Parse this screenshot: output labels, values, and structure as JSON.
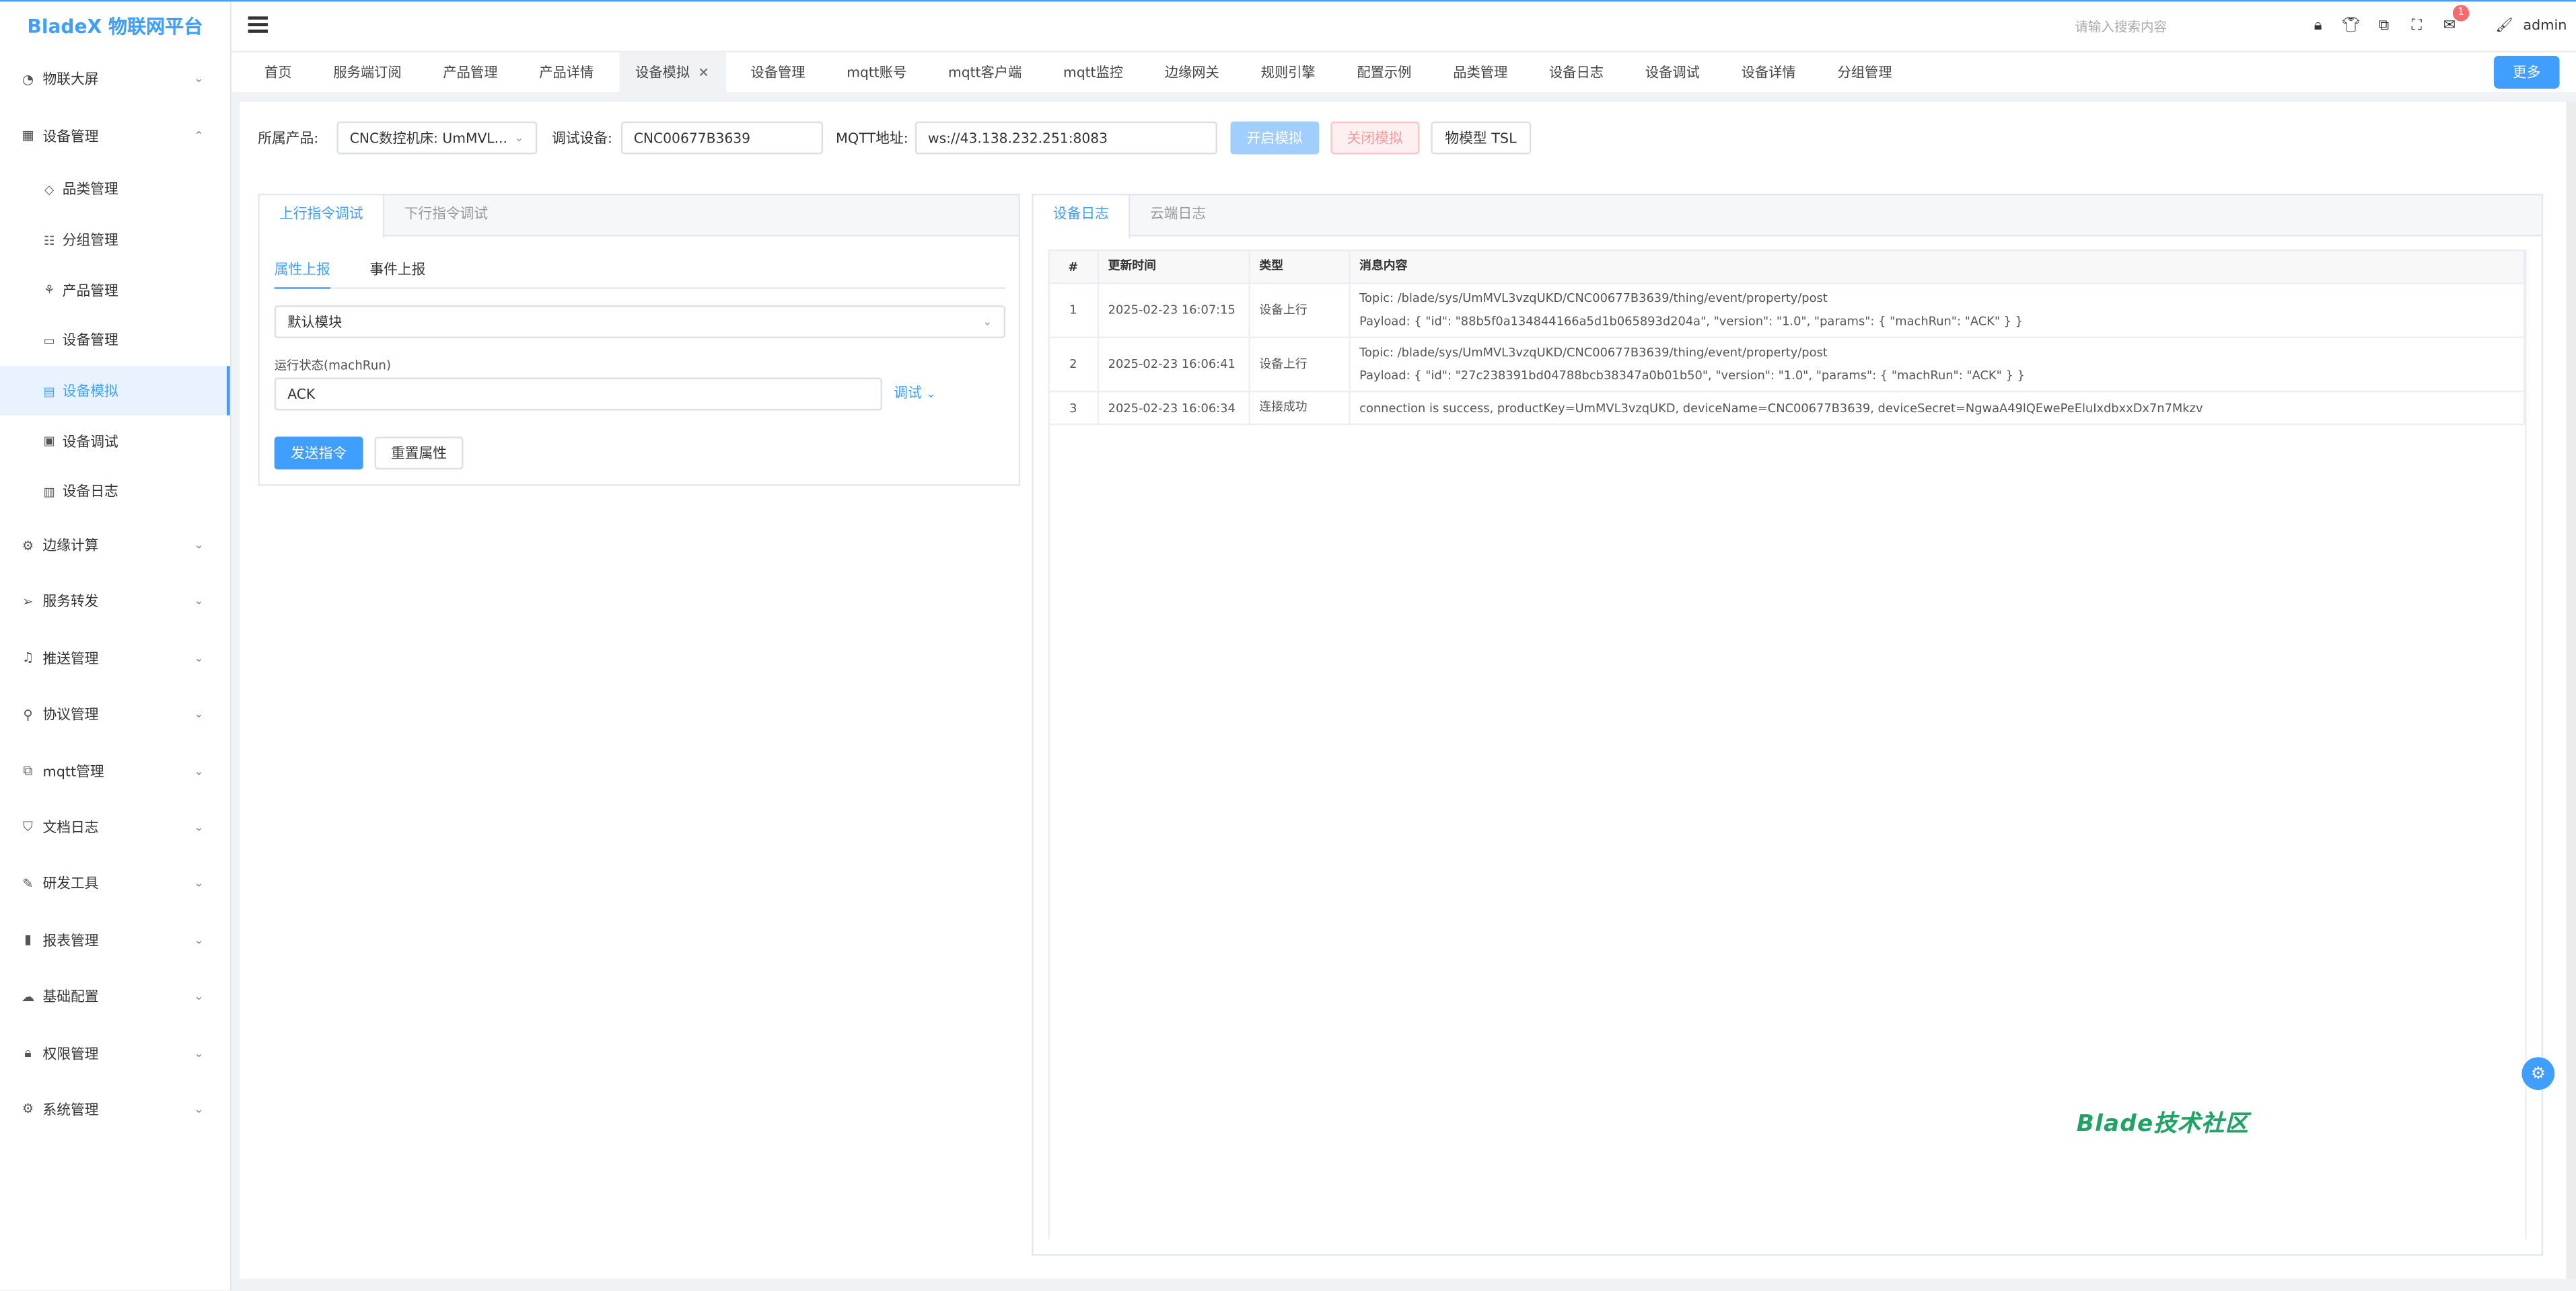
{
  "app": {
    "logo": "BladeX 物联网平台"
  },
  "sidebar": {
    "items": [
      {
        "label": "物联大屏",
        "icon": "dashboard-icon",
        "expanded": false
      },
      {
        "label": "设备管理",
        "icon": "device-icon",
        "expanded": true
      },
      {
        "label": "边缘计算",
        "icon": "edge-icon",
        "expanded": false
      },
      {
        "label": "服务转发",
        "icon": "send-icon",
        "expanded": false
      },
      {
        "label": "推送管理",
        "icon": "bell-icon",
        "expanded": false
      },
      {
        "label": "协议管理",
        "icon": "antenna-icon",
        "expanded": false
      },
      {
        "label": "mqtt管理",
        "icon": "mqtt-icon",
        "expanded": false
      },
      {
        "label": "文档日志",
        "icon": "shield-icon",
        "expanded": false
      },
      {
        "label": "研发工具",
        "icon": "tool-icon",
        "expanded": false
      },
      {
        "label": "报表管理",
        "icon": "bar-chart-icon",
        "expanded": false
      },
      {
        "label": "基础配置",
        "icon": "cloud-icon",
        "expanded": false
      },
      {
        "label": "权限管理",
        "icon": "lock-icon",
        "expanded": false
      },
      {
        "label": "系统管理",
        "icon": "gear-icon",
        "expanded": false
      }
    ],
    "sub_items": [
      {
        "label": "品类管理",
        "icon": "box-icon",
        "active": false
      },
      {
        "label": "分组管理",
        "icon": "group-icon",
        "active": false
      },
      {
        "label": "产品管理",
        "icon": "product-icon",
        "active": false
      },
      {
        "label": "设备管理",
        "icon": "monitor-icon",
        "active": false
      },
      {
        "label": "设备模拟",
        "icon": "simulate-icon",
        "active": true
      },
      {
        "label": "设备调试",
        "icon": "debug-icon",
        "active": false
      },
      {
        "label": "设备日志",
        "icon": "log-icon",
        "active": false
      }
    ]
  },
  "header": {
    "search_placeholder": "请输入搜索内容",
    "notification_count": "1",
    "user": "admin"
  },
  "tabs": {
    "items": [
      "首页",
      "服务端订阅",
      "产品管理",
      "产品详情",
      "设备模拟",
      "设备管理",
      "mqtt账号",
      "mqtt客户端",
      "mqtt监控",
      "边缘网关",
      "规则引擎",
      "配置示例",
      "品类管理",
      "设备日志",
      "设备调试",
      "设备详情",
      "分组管理"
    ],
    "active_index": 4,
    "more_label": "更多"
  },
  "form": {
    "product_label": "所属产品:",
    "product_value": "CNC数控机床: UmMVL...",
    "device_label": "调试设备:",
    "device_value": "CNC00677B3639",
    "mqtt_label": "MQTT地址:",
    "mqtt_value": "ws://43.138.232.251:8083",
    "start_label": "开启模拟",
    "stop_label": "关闭模拟",
    "tsl_label": "物模型 TSL"
  },
  "left_panel": {
    "tabs": [
      "上行指令调试",
      "下行指令调试"
    ],
    "sub_tabs": [
      "属性上报",
      "事件上报"
    ],
    "module_select": "默认模块",
    "property_label": "运行状态(machRun)",
    "property_value": "ACK",
    "debug_label": "调试",
    "send_label": "发送指令",
    "reset_label": "重置属性"
  },
  "right_panel": {
    "tabs": [
      "设备日志",
      "云端日志"
    ],
    "columns": [
      "#",
      "更新时间",
      "类型",
      "消息内容"
    ],
    "rows": [
      {
        "idx": "1",
        "time": "2025-02-23 16:07:15",
        "type": "设备上行",
        "line1": "Topic: /blade/sys/UmMVL3vzqUKD/CNC00677B3639/thing/event/property/post",
        "line2": "Payload: { \"id\": \"88b5f0a134844166a5d1b065893d204a\", \"version\": \"1.0\", \"params\": { \"machRun\": \"ACK\" } }"
      },
      {
        "idx": "2",
        "time": "2025-02-23 16:06:41",
        "type": "设备上行",
        "line1": "Topic: /blade/sys/UmMVL3vzqUKD/CNC00677B3639/thing/event/property/post",
        "line2": "Payload: { \"id\": \"27c238391bd04788bcb38347a0b01b50\", \"version\": \"1.0\", \"params\": { \"machRun\": \"ACK\" } }"
      },
      {
        "idx": "3",
        "time": "2025-02-23 16:06:34",
        "type": "连接成功",
        "line1": "connection is success, productKey=UmMVL3vzqUKD, deviceName=CNC00677B3639, deviceSecret=NgwaA49lQEwePeEluIxdbxxDx7n7Mkzv",
        "line2": ""
      }
    ]
  },
  "watermark": "Blade技术社区",
  "colors": {
    "primary": "#409eff",
    "danger": "#f56c6c",
    "success": "#21a366"
  }
}
